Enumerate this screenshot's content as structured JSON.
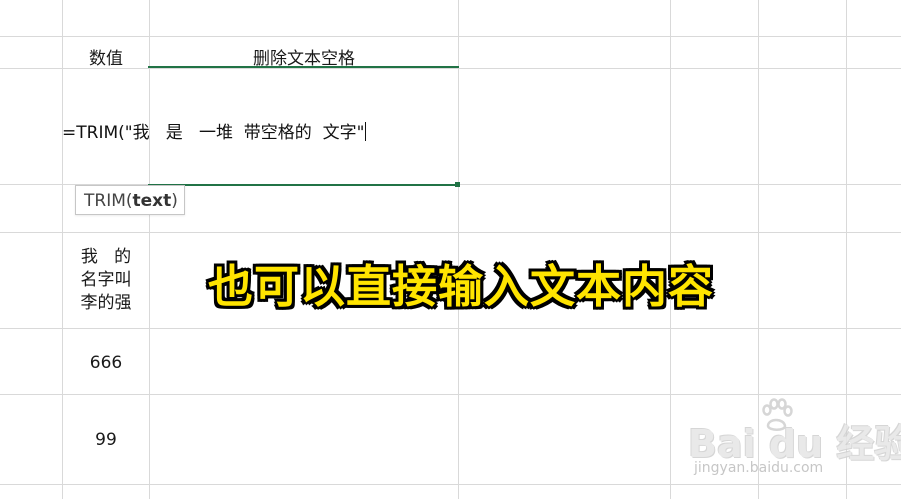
{
  "sheet": {
    "header": {
      "value_col": "数值",
      "trim_col": "删除文本空格"
    },
    "formula_text": "=TRIM(\"我   是   一堆  带空格的  文字\"",
    "tooltip": {
      "fn_name": "TRIM(",
      "arg": "text",
      "close": ")"
    },
    "wrapped_cell_lines": [
      "我   的",
      "名字叫",
      "李的强"
    ],
    "rows": [
      "666",
      "99"
    ]
  },
  "overlay_caption": "也可以直接输入文本内容",
  "watermark": {
    "brand": "Bai du 经验",
    "url": "jingyan.baidu.com"
  },
  "colors": {
    "accent": "#217346",
    "caption": "#ffe400",
    "gridline": "#d9d9d9"
  }
}
